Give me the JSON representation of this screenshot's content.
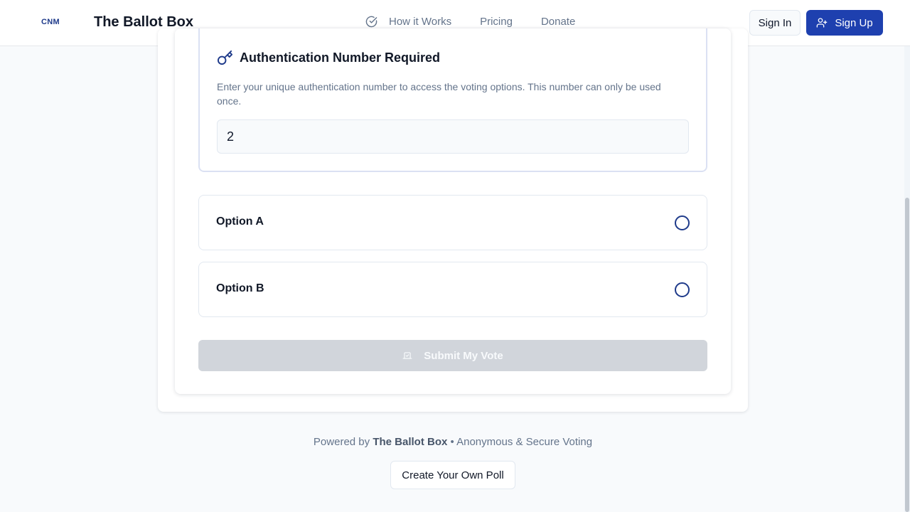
{
  "header": {
    "logo_text": "CNM",
    "brand": "The Ballot Box",
    "nav": [
      {
        "label": "How it Works",
        "icon": "check-circle-icon"
      },
      {
        "label": "Pricing"
      },
      {
        "label": "Donate"
      }
    ],
    "sign_in": "Sign In",
    "sign_up": "Sign Up",
    "sign_up_icon": "user-plus-icon"
  },
  "auth": {
    "icon": "key-icon",
    "title": "Authentication Number Required",
    "description": "Enter your unique authentication number to access the voting options. This number can only be used once.",
    "input_value": "2"
  },
  "options": [
    {
      "label": "Option A",
      "selected": false
    },
    {
      "label": "Option B",
      "selected": false
    }
  ],
  "submit": {
    "label": "Submit My Vote",
    "icon": "ballot-box-icon",
    "disabled": true
  },
  "footer": {
    "powered_by": "Powered by",
    "brand": "The Ballot Box",
    "separator": "•",
    "tagline": "Anonymous & Secure Voting",
    "create_poll": "Create Your Own Poll"
  },
  "colors": {
    "primary": "#1e40af",
    "radio_border": "#1e3a8a",
    "disabled_button": "#d1d5db",
    "background": "#f8fafc"
  }
}
